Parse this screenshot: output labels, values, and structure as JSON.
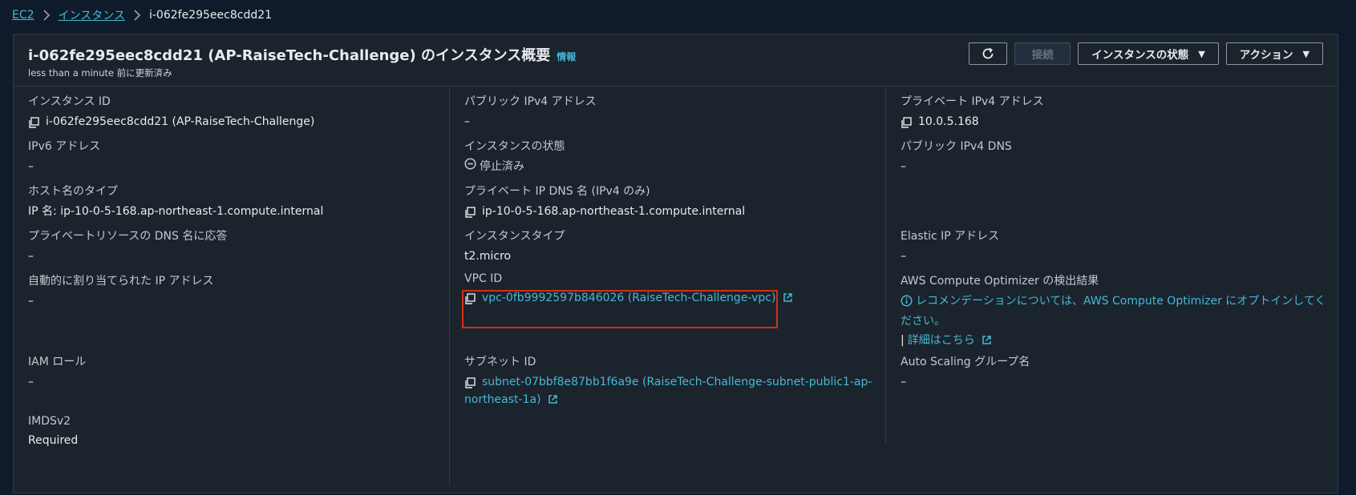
{
  "breadcrumb": {
    "items": [
      "EC2",
      "インスタンス"
    ],
    "current": "i-062fe295eec8cdd21"
  },
  "header": {
    "title": "i-062fe295eec8cdd21 (AP-RaiseTech-Challenge) のインスタンス概要",
    "info": "情報",
    "updated": "less than a minute 前に更新済み",
    "buttons": {
      "connect": "接続",
      "instance_state": "インスタンスの状態",
      "actions": "アクション"
    }
  },
  "col1": {
    "instance_id": {
      "label": "インスタンス ID",
      "value": "i-062fe295eec8cdd21 (AP-RaiseTech-Challenge)"
    },
    "ipv6": {
      "label": "IPv6 アドレス",
      "value": "–"
    },
    "hostname_type": {
      "label": "ホスト名のタイプ",
      "value": "IP 名: ip-10-0-5-168.ap-northeast-1.compute.internal"
    },
    "private_dns_answer": {
      "label": "プライベートリソースの DNS 名に応答",
      "value": "–"
    },
    "auto_ip": {
      "label": "自動的に割り当てられた IP アドレス",
      "value": "–"
    },
    "iam_role": {
      "label": "IAM ロール",
      "value": "–"
    },
    "imdsv2": {
      "label": "IMDSv2",
      "value": "Required"
    }
  },
  "col2": {
    "public_ipv4": {
      "label": "パブリック IPv4 アドレス",
      "value": "–"
    },
    "instance_state": {
      "label": "インスタンスの状態",
      "value": "停止済み"
    },
    "private_ip_dns": {
      "label": "プライベート IP DNS 名 (IPv4 のみ)",
      "value": "ip-10-0-5-168.ap-northeast-1.compute.internal"
    },
    "instance_type": {
      "label": "インスタンスタイプ",
      "value": "t2.micro"
    },
    "vpc_id": {
      "label": "VPC ID",
      "value": "vpc-0fb9992597b846026 (RaiseTech-Challenge-vpc)"
    },
    "subnet_id": {
      "label": "サブネット ID",
      "value_line1": "subnet-07bbf8e87bb1f6a9e (RaiseTech-Challenge-subnet-public1-ap-",
      "value_line2": "northeast-1a)"
    }
  },
  "col3": {
    "private_ipv4": {
      "label": "プライベート IPv4 アドレス",
      "value": "10.0.5.168"
    },
    "public_dns": {
      "label": "パブリック IPv4 DNS",
      "value": "–"
    },
    "elastic_ip": {
      "label": "Elastic IP アドレス",
      "value": "–"
    },
    "optimizer": {
      "label": "AWS Compute Optimizer の検出結果",
      "message_line1": "レコメンデーションについては、AWS Compute Optimizer にオプトインしてく",
      "message_line2": "ださい。",
      "details_link": "詳細はこちら"
    },
    "asg": {
      "label": "Auto Scaling グループ名",
      "value": "–"
    }
  },
  "colors": {
    "link": "#44b9d6",
    "highlight": "#d13212",
    "background": "#0f1b2a",
    "panel": "#1b232d"
  }
}
